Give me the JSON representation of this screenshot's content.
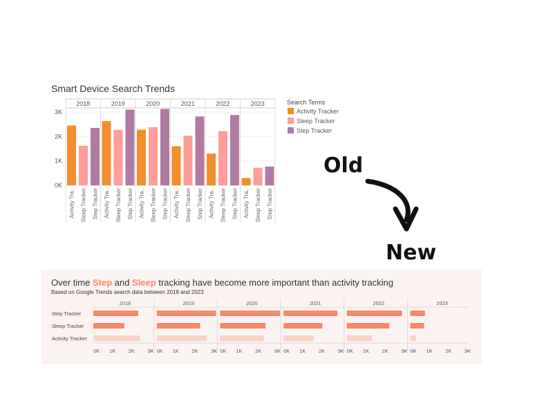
{
  "annotations": {
    "old": "Old",
    "new": "New"
  },
  "colors": {
    "activity_old": "#f28e2b",
    "sleep_old": "#ff9d9a",
    "step_old": "#b07aa1",
    "step_new": "#f5896e",
    "sleep_new": "#f5896e",
    "activity_new": "#f8d3c6",
    "panel_bg": "#fbf3f1"
  },
  "chart_data": [
    {
      "type": "bar",
      "title": "Smart Device Search Trends",
      "facets": [
        "2018",
        "2019",
        "2020",
        "2021",
        "2022",
        "2023"
      ],
      "categories": [
        "Activity Tra..",
        "Sleep Tracker",
        "Step Tracker"
      ],
      "series": [
        {
          "name": "Activity Tracker",
          "values": [
            2450,
            2630,
            2280,
            1600,
            1300,
            300
          ]
        },
        {
          "name": "Sleep Tracker",
          "values": [
            1620,
            2270,
            2380,
            2030,
            2220,
            720
          ]
        },
        {
          "name": "Step Tracker",
          "values": [
            2350,
            3100,
            3130,
            2820,
            2880,
            770
          ]
        }
      ],
      "y_ticks": [
        "0K",
        "1K",
        "2K",
        "3K"
      ],
      "ylim": [
        0,
        3200
      ],
      "legend": {
        "title": "Search Terms",
        "position": "right"
      }
    },
    {
      "type": "bar",
      "orientation": "horizontal",
      "title": {
        "parts": [
          {
            "text": "Over time ",
            "highlight": false
          },
          {
            "text": "Step",
            "highlight": true
          },
          {
            "text": " and ",
            "highlight": false
          },
          {
            "text": "Sleep",
            "highlight": true
          },
          {
            "text": " tracking have become more important than activity tracking",
            "highlight": false
          }
        ]
      },
      "subtitle": "Based on Google Trends search data between 2018 and 2023",
      "facets": [
        "2018",
        "2019",
        "2020",
        "2021",
        "2022",
        "2023"
      ],
      "categories": [
        "Step Tracker",
        "Sleep Tracker",
        "Activity Tracker"
      ],
      "series": [
        {
          "name": "Step Tracker",
          "values": [
            2350,
            3100,
            3130,
            2820,
            2880,
            770
          ]
        },
        {
          "name": "Sleep Tracker",
          "values": [
            1620,
            2270,
            2380,
            2030,
            2220,
            720
          ]
        },
        {
          "name": "Activity Tracker",
          "values": [
            2450,
            2630,
            2280,
            1600,
            1300,
            300
          ]
        }
      ],
      "x_ticks": [
        "0K",
        "1K",
        "2K",
        "3K"
      ],
      "xlim": [
        0,
        3200
      ]
    }
  ]
}
